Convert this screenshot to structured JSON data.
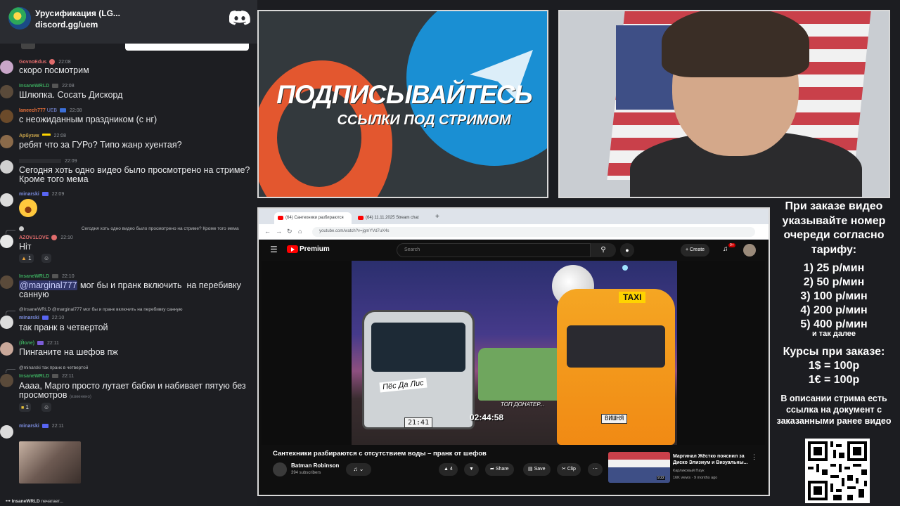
{
  "server": {
    "name": "Урусификация (LG...",
    "link": "discord.gg/uem"
  },
  "messages": [
    {
      "user": "GovnoEdus",
      "time": "22:08",
      "text": "скоро посмотрим",
      "color": "#e06c6c"
    },
    {
      "user": "InsaneWRLD",
      "time": "22:08",
      "text": "Шлюпка. Сосать Дискорд",
      "color": "#3ba55c"
    },
    {
      "user": "Ianeech777",
      "time": "22:08",
      "badge": "UEB",
      "text": "с неожиданным праздником (с нг)",
      "color": "#e8703a"
    },
    {
      "user": "Арбузик",
      "time": "22:08",
      "text": "ребят что за ГУРо? Типо жанр хуентая?",
      "color": "#c7a34b"
    },
    {
      "user": "",
      "time": "22:09",
      "text": "Сегодня хоть одно видео было просмотрено на стриме? Кроме того мема",
      "color": "#8e9297"
    },
    {
      "user": "minarski",
      "time": "22:09",
      "text": "",
      "color": "#7b8cde"
    },
    {
      "user": "AZOV1LOVE",
      "time": "22:10",
      "reply": "Сегодня хоть одно видео было просмотрено на стриме? Кроме того мема",
      "text": "Ніт",
      "reaction": "1",
      "color": "#e06c6c"
    },
    {
      "user": "InsaneWRLD",
      "time": "22:10",
      "mention": "@marginal777",
      "text": " мог бы и пранк включить  на перебивку санную",
      "color": "#3ba55c"
    },
    {
      "user": "minarski",
      "time": "22:10",
      "reply": "@InsaneWRLD @marginal777 мог бы и пранк включить  на перебивку санную",
      "text": "так пранк в четвертой",
      "color": "#7b8cde"
    },
    {
      "user": "(Йоле)",
      "time": "22:11",
      "text": "Пинганите на шефов пж",
      "color": "#3ba55c"
    },
    {
      "user": "InsaneWRLD",
      "time": "22:11",
      "reply": "@minarski так пранк в четвертой",
      "text": "Аааа, Марго просто лутает бабки и набивает пятую без просмотров",
      "edited": "(изменено)",
      "reaction": "1",
      "color": "#3ba55c"
    },
    {
      "user": "minarski",
      "time": "22:11",
      "text": "",
      "color": "#7b8cde"
    }
  ],
  "typing": {
    "user": "InsaneWRLD",
    "text": "печатает..."
  },
  "promo": {
    "title": "ПОДПИСЫВАЙТЕСЬ",
    "subtitle": "ССЫЛКИ ПОД СТРИМОМ"
  },
  "browser": {
    "tab1": "(64) Сантехники разбираются",
    "tab2": "(64) 11.11.2025 Stream chat",
    "url": "youtube.com/watch?v=jgmYVd7uX4s"
  },
  "youtube": {
    "logo": "Premium",
    "search_placeholder": "Search",
    "create_label": "Create",
    "notif_count": "9+",
    "video_title": "Сантехники разбираются с отсутствием воды – пранк от шефов",
    "channel_name": "Batman Robinson",
    "channel_subs": "394 subscribers",
    "likes": "4",
    "share_label": "Share",
    "save_label": "Save",
    "clip_label": "Clip",
    "thumb_label_jeep": "Пёс Да Лис",
    "thumb_plate1": "21:41",
    "thumb_taxi": "TAXI",
    "thumb_plate2": "ВИШНЯ",
    "thumb_donater": "ТОП ДОНАТЕР...",
    "thumb_timer": "02:44:58",
    "rec_title": "Маргинал Жёстко пояснил за Диско Элизиум и Визуальны...",
    "rec_channel": "Карликовый Паук",
    "rec_meta": "16K views · 9 months ago",
    "rec_duration": "9:22"
  },
  "info": {
    "order_text": "При заказе видео указывайте номер очереди согласно тарифу:",
    "tariffs": [
      "1) 25 р/мин",
      "2) 50 р/мин",
      "3) 100 р/мин",
      "4) 200 р/мин",
      "5) 400 р/мин"
    ],
    "etc": "и так далее",
    "rates_title": "Курсы при заказе:",
    "rate1": "1$ = 100р",
    "rate2": "1€ = 100р",
    "description": "В описании стрима есть ссылка на документ с заказанными ранее видео"
  }
}
